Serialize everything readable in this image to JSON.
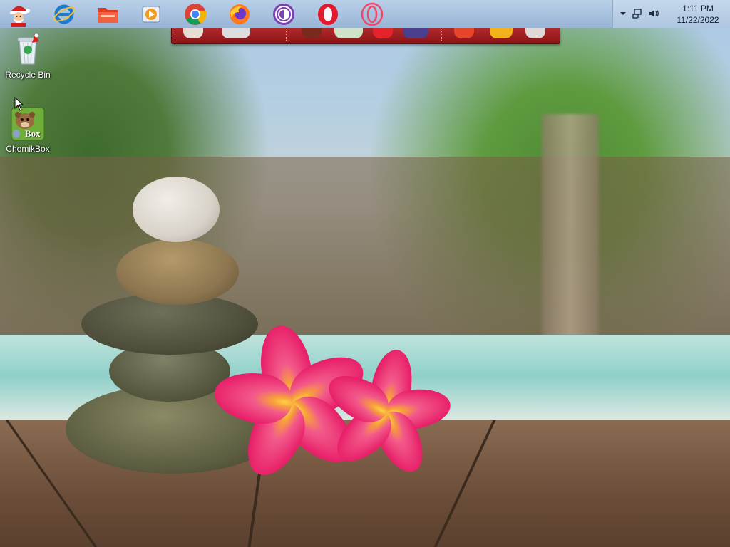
{
  "taskbar": {
    "start_button": {
      "icon": "santa-start-icon"
    },
    "pinned": [
      {
        "name": "internet-explorer-icon",
        "color": "#1b7bd1"
      },
      {
        "name": "file-explorer-icon",
        "color": "#e23b24"
      },
      {
        "name": "media-player-icon",
        "color": "#f39a1e"
      },
      {
        "name": "chrome-icon",
        "color": "#4caf50"
      },
      {
        "name": "firefox-icon",
        "color": "#ff7a1a"
      },
      {
        "name": "tor-browser-icon",
        "color": "#7d3fb2"
      },
      {
        "name": "opera-icon",
        "color": "#e01a2c"
      },
      {
        "name": "opera-gx-icon",
        "color": "#f0486a"
      }
    ],
    "tray": {
      "icons": [
        "chevron-up-icon",
        "network-icon",
        "volume-icon"
      ],
      "clock_time": "1:11 PM",
      "clock_date": "11/22/2022"
    }
  },
  "desktop": {
    "icons": [
      {
        "label": "Recycle Bin",
        "icon": "recycle-bin-icon"
      },
      {
        "label": "ChomikBox",
        "icon": "chomikbox-icon",
        "badge": "Box"
      }
    ]
  },
  "colors": {
    "taskbar": "#a8c2df",
    "dock": "#a3201f"
  }
}
